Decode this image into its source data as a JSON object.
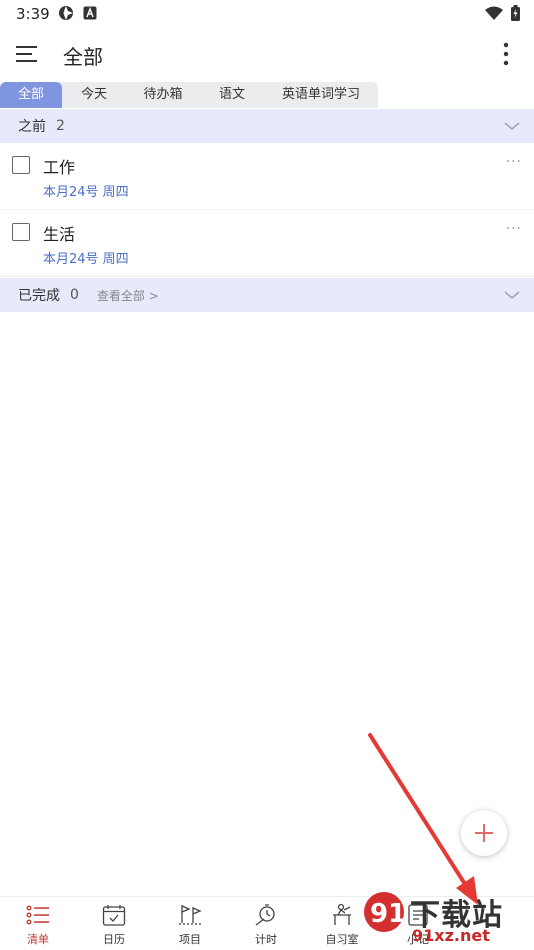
{
  "status": {
    "time": "3:39"
  },
  "app_bar": {
    "title": "全部"
  },
  "tabs": [
    {
      "label": "全部",
      "active": true
    },
    {
      "label": "今天",
      "active": false
    },
    {
      "label": "待办箱",
      "active": false
    },
    {
      "label": "语文",
      "active": false
    },
    {
      "label": "英语单词学习",
      "active": false
    }
  ],
  "before_section": {
    "title": "之前",
    "count": "2"
  },
  "tasks": [
    {
      "title": "工作",
      "date": "本月24号 周四",
      "more": "···"
    },
    {
      "title": "生活",
      "date": "本月24号 周四",
      "more": "···"
    }
  ],
  "completed_section": {
    "title": "已完成",
    "count": "0",
    "link": "查看全部 >"
  },
  "bottom_nav": [
    {
      "label": "清单",
      "icon": "list-icon",
      "active": true
    },
    {
      "label": "日历",
      "icon": "calendar-icon",
      "active": false
    },
    {
      "label": "项目",
      "icon": "project-icon",
      "active": false
    },
    {
      "label": "计时",
      "icon": "timer-icon",
      "active": false
    },
    {
      "label": "自习室",
      "icon": "study-room-icon",
      "active": false
    },
    {
      "label": "小记",
      "icon": "note-icon",
      "active": false
    }
  ],
  "watermark": {
    "text": "下载站",
    "url": "91xz.net"
  },
  "colors": {
    "accent": "#7f95e0",
    "section_bg": "#e6eafa",
    "date": "#4a6fc7",
    "nav_active": "#c0392b",
    "arrow": "#e53935"
  }
}
